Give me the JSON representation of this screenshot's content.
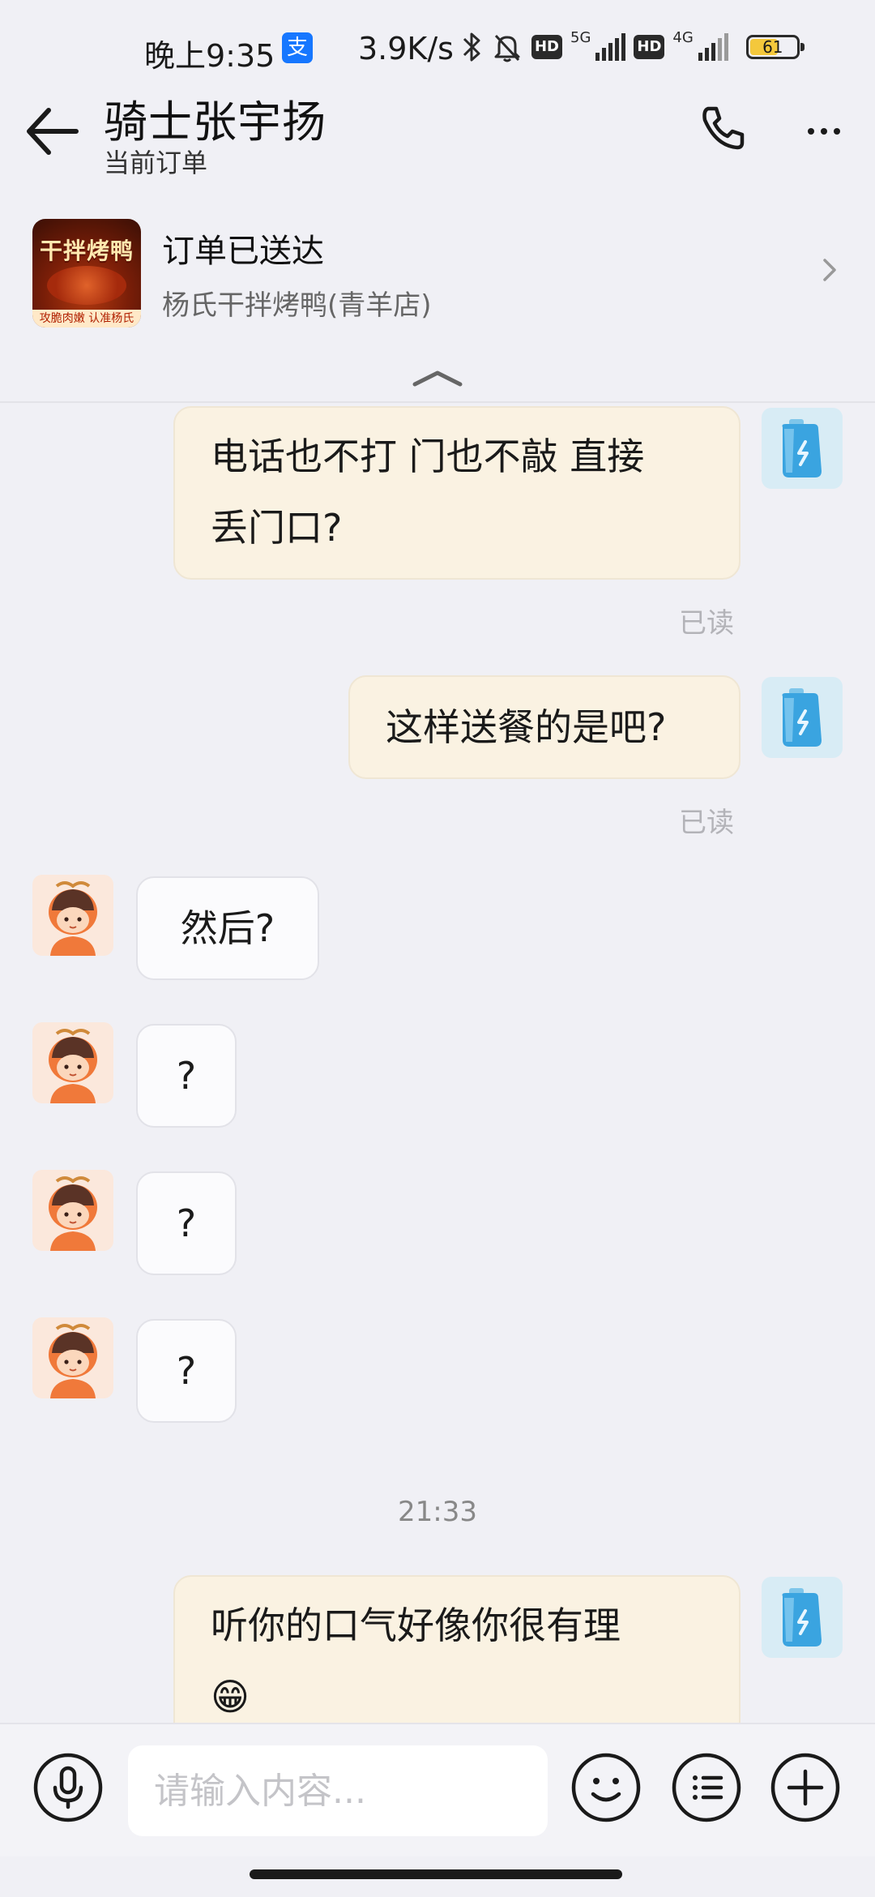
{
  "status_bar": {
    "time": "晚上9:35",
    "alipay_glyph": "支",
    "net_speed": "3.9K/s",
    "hd1": "HD",
    "net1": "5G",
    "hd2": "HD",
    "net2": "4G",
    "battery": "61",
    "battery_level": 0.61,
    "icons": [
      "alipay-icon",
      "bluetooth-icon",
      "mute-icon",
      "signal-icon",
      "battery-icon"
    ]
  },
  "header": {
    "title": "骑士张宇扬",
    "subtitle": "当前订单"
  },
  "order": {
    "thumb_brand": "干拌烤鸭",
    "thumb_slogan": "攻脆肉嫩 认准杨氏",
    "status": "订单已送达",
    "shop": "杨氏干拌烤鸭(青羊店)"
  },
  "messages": {
    "m1_line1": "电话也不打 门也不敲 直接",
    "m1_line2": "丢门口?",
    "m1_read": "已读",
    "m2": "这样送餐的是吧?",
    "m2_read": "已读",
    "m3": "然后?",
    "m4": "?",
    "m5": "?",
    "m6": "?",
    "timestamp": "21:33",
    "m7_line1": "听你的口气好像你很有理",
    "m7_emoji": "😁"
  },
  "input": {
    "placeholder": "请输入内容..."
  },
  "colors": {
    "outgoing_bubble": "#faf2e2",
    "incoming_bubble": "#fbfbfd",
    "background": "#f0f0f5"
  }
}
